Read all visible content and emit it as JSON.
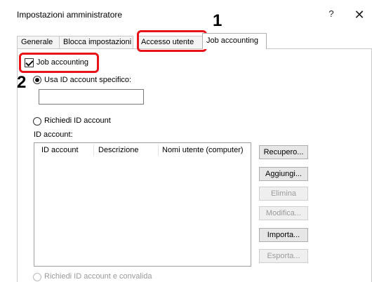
{
  "window": {
    "title": "Impostazioni amministratore",
    "help_glyph": "?",
    "close_glyph": "✕"
  },
  "tabs": [
    {
      "label": "Generale",
      "active": false
    },
    {
      "label": "Blocca impostazioni",
      "active": false
    },
    {
      "label": "Accesso utente",
      "active": false
    },
    {
      "label": "Job accounting",
      "active": true
    }
  ],
  "job_accounting": {
    "checkbox_label": "Job accounting",
    "checked": true,
    "use_specific_id_label": "Usa ID account specifico:",
    "specific_id_value": "",
    "request_id_label": "Richiedi ID account",
    "id_account_label": "ID account:",
    "columns": [
      "ID account",
      "Descrizione",
      "Nomi utente (computer)"
    ],
    "rows": [],
    "request_validate_label": "Richiedi ID account e convalida"
  },
  "buttons": [
    {
      "label": "Recupero...",
      "enabled": true
    },
    {
      "label": "Aggiungi...",
      "enabled": true
    },
    {
      "label": "Elimina",
      "enabled": false
    },
    {
      "label": "Modifica...",
      "enabled": false
    },
    {
      "label": "Importa...",
      "enabled": true
    },
    {
      "label": "Esporta...",
      "enabled": false
    }
  ],
  "annotations": {
    "step1": "1",
    "step2": "2",
    "color": "#e8121b"
  }
}
